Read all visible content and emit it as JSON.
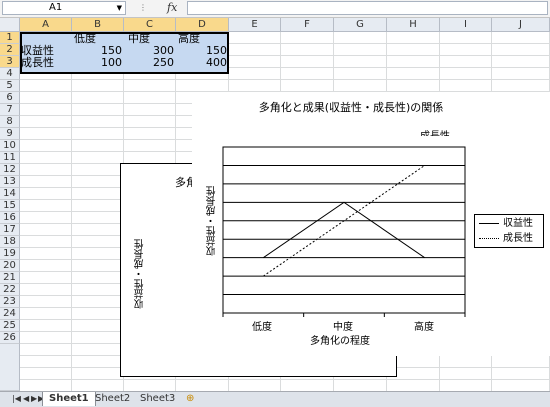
{
  "name_box": "A1",
  "fx_label": "fx",
  "columns": [
    "A",
    "B",
    "C",
    "D",
    "E",
    "F",
    "G",
    "H",
    "I",
    "J"
  ],
  "rows": [
    "1",
    "2",
    "3",
    "4",
    "5",
    "6",
    "7",
    "8",
    "9",
    "10",
    "11",
    "12",
    "13",
    "14",
    "15",
    "16",
    "17",
    "18",
    "19",
    "20",
    "21",
    "22",
    "23",
    "24",
    "25",
    "26"
  ],
  "cells": {
    "b1": "低度",
    "c1": "中度",
    "d1": "高度",
    "a2": "収益性",
    "b2": "150",
    "c2": "300",
    "d2": "150",
    "a3": "成長性",
    "b3": "100",
    "c3": "250",
    "d3": "400"
  },
  "back_chart": {
    "title_partial": "多角",
    "ylabel": "収益性・成長性"
  },
  "front_chart": {
    "ghost_text": "成長性"
  },
  "chart_data": {
    "type": "line",
    "title": "多角化と成果(収益性・成長性)の関係",
    "categories": [
      "低度",
      "中度",
      "高度"
    ],
    "xlabel": "多角化の程度",
    "ylabel": "収益性・成長性",
    "ylim": [
      0,
      450
    ],
    "y_gridlines": 50,
    "series": [
      {
        "name": "収益性",
        "values": [
          150,
          300,
          150
        ],
        "style": "solid"
      },
      {
        "name": "成長性",
        "values": [
          100,
          250,
          400
        ],
        "style": "dotted"
      }
    ],
    "legend_position": "right"
  },
  "sheet_tabs": [
    "Sheet1",
    "Sheet2",
    "Sheet3"
  ],
  "active_tab": "Sheet1",
  "colors": {
    "selection": "#c6d9f1",
    "header_selected": "#f9d98c",
    "grid": "#dadcdd"
  }
}
